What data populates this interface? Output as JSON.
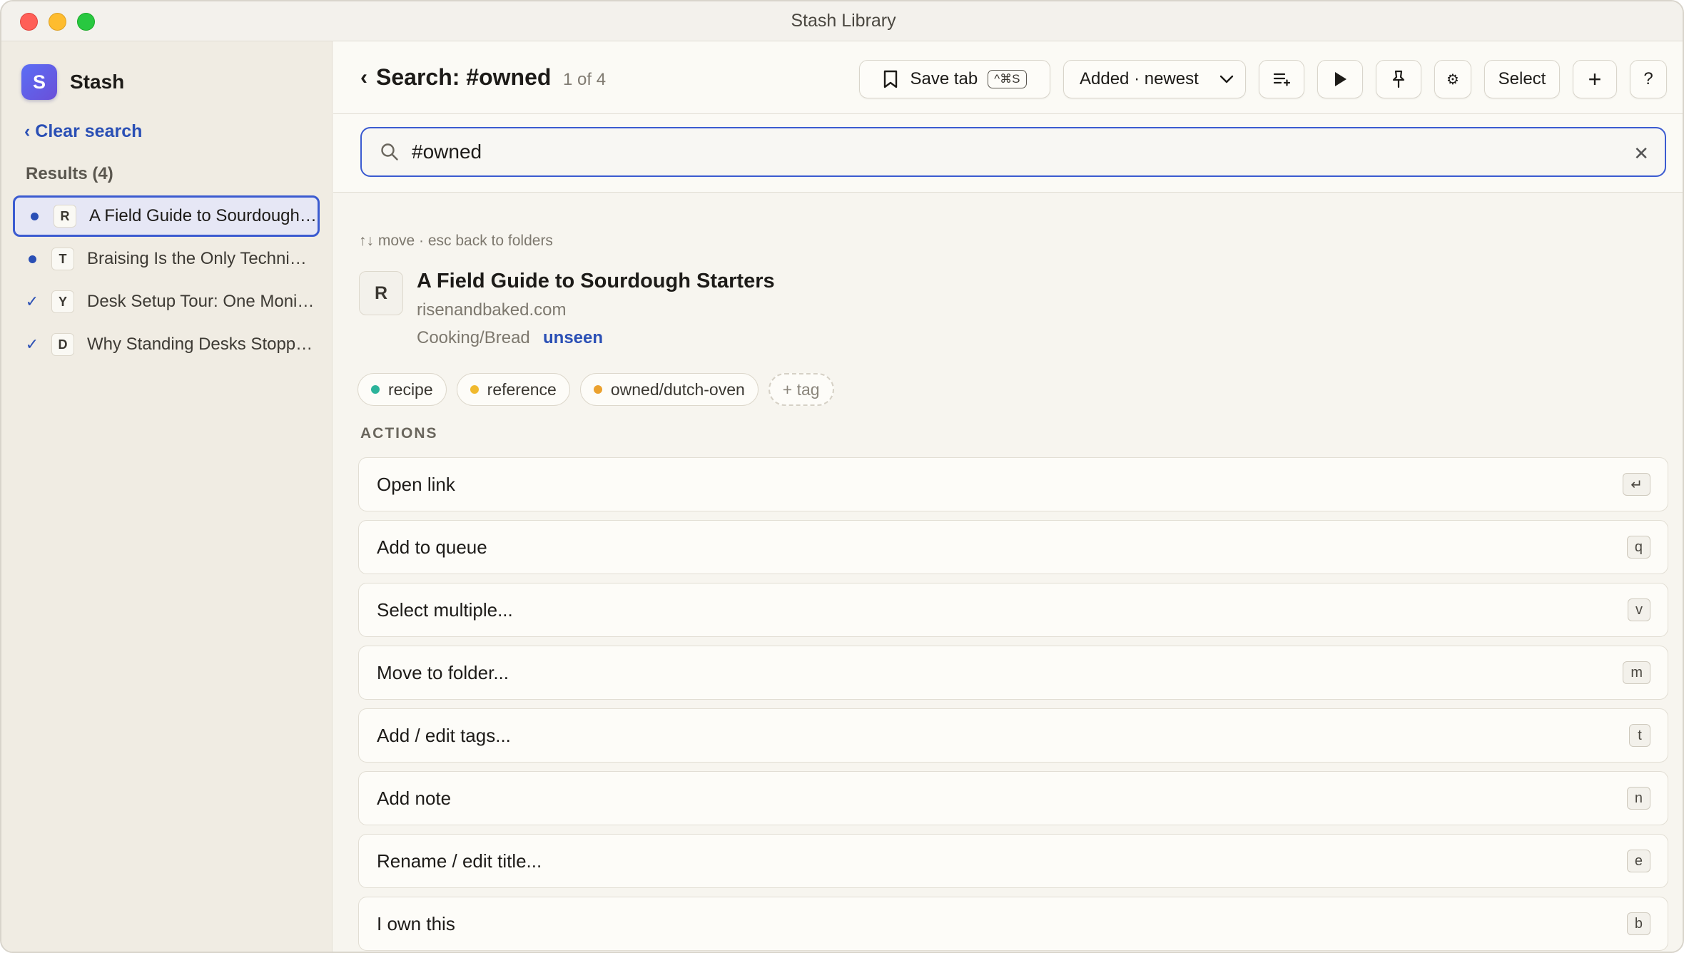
{
  "window": {
    "title": "Stash Library"
  },
  "sidebar": {
    "brand_letter": "S",
    "brand_name": "Stash",
    "clear_search": "‹ Clear search",
    "results_heading": "Results (4)",
    "results": [
      {
        "badge": "R",
        "title": "A Field Guide to Sourdough Starters",
        "state": "unread",
        "selected": true
      },
      {
        "badge": "T",
        "title": "Braising Is the Only Technique You Need",
        "state": "unread",
        "selected": false
      },
      {
        "badge": "Y",
        "title": "Desk Setup Tour: One Monitor, Zero Clutter",
        "state": "done",
        "selected": false
      },
      {
        "badge": "D",
        "title": "Why Standing Desks Stopped Working for Me",
        "state": "done",
        "selected": false
      }
    ]
  },
  "header": {
    "back": "‹",
    "title": "Search: #owned",
    "count": "1 of 4",
    "save_tab": "Save tab",
    "save_tab_shortcut": "^⌘S",
    "sort": "Added · newest",
    "select": "Select",
    "add": "+",
    "help": "?"
  },
  "search": {
    "value": "#owned",
    "placeholder": "Search"
  },
  "hint": "↑↓ move · esc back to folders",
  "item": {
    "badge": "R",
    "title": "A Field Guide to Sourdough Starters",
    "domain": "risenandbaked.com",
    "folder": "Cooking/Bread",
    "status": "unseen",
    "tags": [
      {
        "label": "recipe",
        "color": "#2bb39a"
      },
      {
        "label": "reference",
        "color": "#f0b92d"
      },
      {
        "label": "owned/dutch-oven",
        "color": "#eba12e"
      }
    ],
    "add_tag": "+ tag"
  },
  "actions_heading": "ACTIONS",
  "actions": [
    {
      "label": "Open link",
      "key": "↵"
    },
    {
      "label": "Add to queue",
      "key": "q"
    },
    {
      "label": "Select multiple...",
      "key": "v"
    },
    {
      "label": "Move to folder...",
      "key": "m"
    },
    {
      "label": "Add / edit tags...",
      "key": "t"
    },
    {
      "label": "Add note",
      "key": "n"
    },
    {
      "label": "Rename / edit title...",
      "key": "e"
    },
    {
      "label": "I own this",
      "key": "b"
    }
  ],
  "colors": {
    "accent": "#3b5bd0",
    "link": "#2a4fb5",
    "background": "#f7f5ef"
  }
}
